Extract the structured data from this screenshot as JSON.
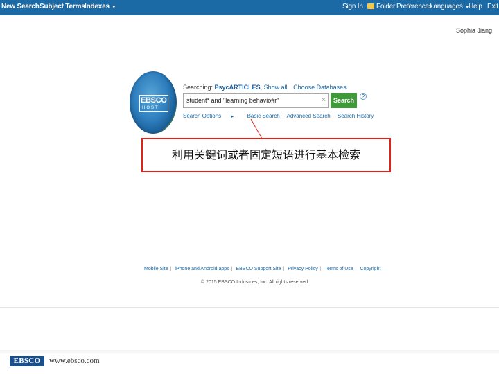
{
  "topbar": {
    "new_search": "New Search",
    "subject_terms": "Subject Terms",
    "indexes": "Indexes",
    "sign_in": "Sign In",
    "folder": "Folder",
    "preferences": "Preferences",
    "languages": "Languages",
    "help": "Help",
    "exit": "Exit",
    "bg_color": "#1b6aa5"
  },
  "user": {
    "name": "Sophia Jiang"
  },
  "logo": {
    "text": "EBSCO",
    "sub": "HOST"
  },
  "search": {
    "searching_prefix": "Searching:",
    "database": "PsycARTICLES",
    "show_all": "Show all",
    "choose_databases": "Choose Databases",
    "query": "student* and \"learning behavio#r\"",
    "button_label": "Search",
    "help_symbol": "?",
    "clear_symbol": "×",
    "links": {
      "search_options": "Search Options",
      "basic_search": "Basic Search",
      "advanced_search": "Advanced Search",
      "search_history": "Search History"
    },
    "button_color": "#3f9a3a"
  },
  "callout": {
    "text": "利用关键词或者固定短语进行基本检索",
    "border_color": "#d9261c"
  },
  "footer": {
    "links": [
      "Mobile Site",
      "iPhone and Android apps",
      "EBSCO Support Site",
      "Privacy Policy",
      "Terms of Use",
      "Copyright"
    ],
    "copyright": "© 2015 EBSCO Industries, Inc. All rights reserved."
  },
  "brand": {
    "logo": "EBSCO",
    "url": "www.ebsco.com"
  }
}
